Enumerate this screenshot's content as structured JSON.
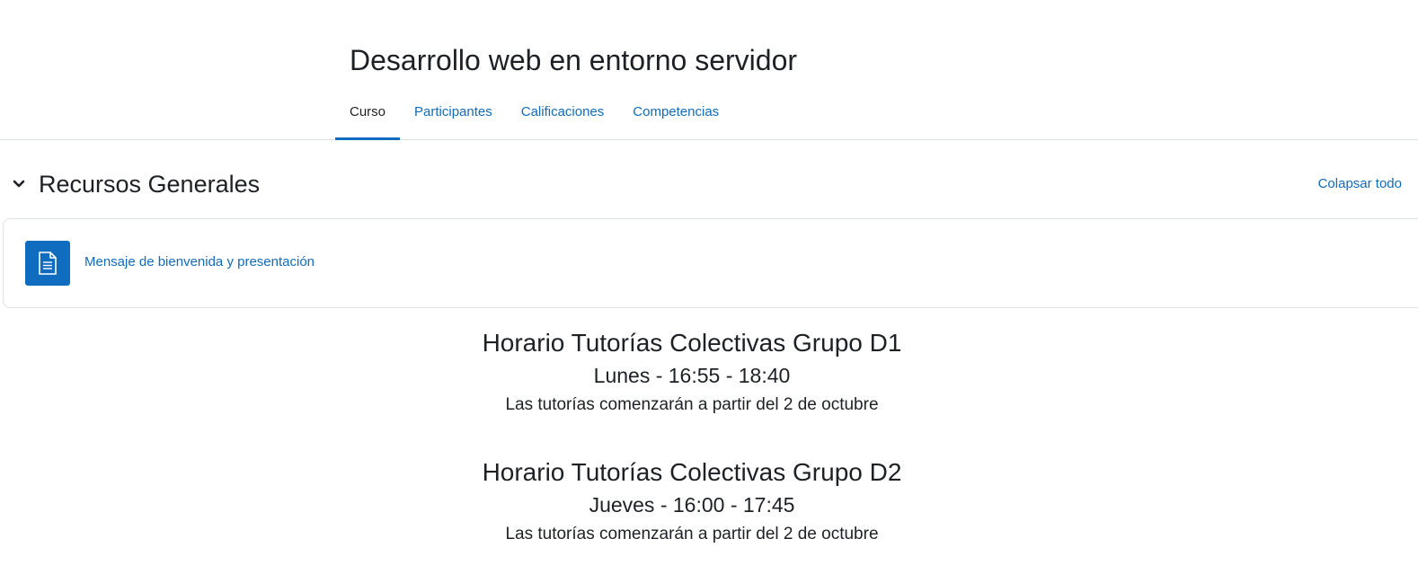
{
  "course": {
    "title": "Desarrollo web en entorno servidor"
  },
  "tabs": [
    {
      "label": "Curso",
      "active": true
    },
    {
      "label": "Participantes",
      "active": false
    },
    {
      "label": "Calificaciones",
      "active": false
    },
    {
      "label": "Competencias",
      "active": false
    }
  ],
  "section": {
    "title": "Recursos Generales",
    "collapse_all_label": "Colapsar todo",
    "chevron_icon": "chevron-down-icon"
  },
  "activity": {
    "icon": "document-icon",
    "label": "Mensaje de bienvenida y presentación"
  },
  "schedules": [
    {
      "title": "Horario Tutorías Colectivas Grupo D1",
      "time": "Lunes - 16:55 - 18:40",
      "note": "Las tutorías comenzarán a partir del 2 de octubre"
    },
    {
      "title": "Horario Tutorías Colectivas Grupo D2",
      "time": "Jueves - 16:00 - 17:45",
      "note": "Las tutorías comenzarán a partir del 2 de octubre"
    }
  ],
  "colors": {
    "link": "#0f6cbf",
    "text": "#1d2125",
    "border": "#dee2e6"
  }
}
